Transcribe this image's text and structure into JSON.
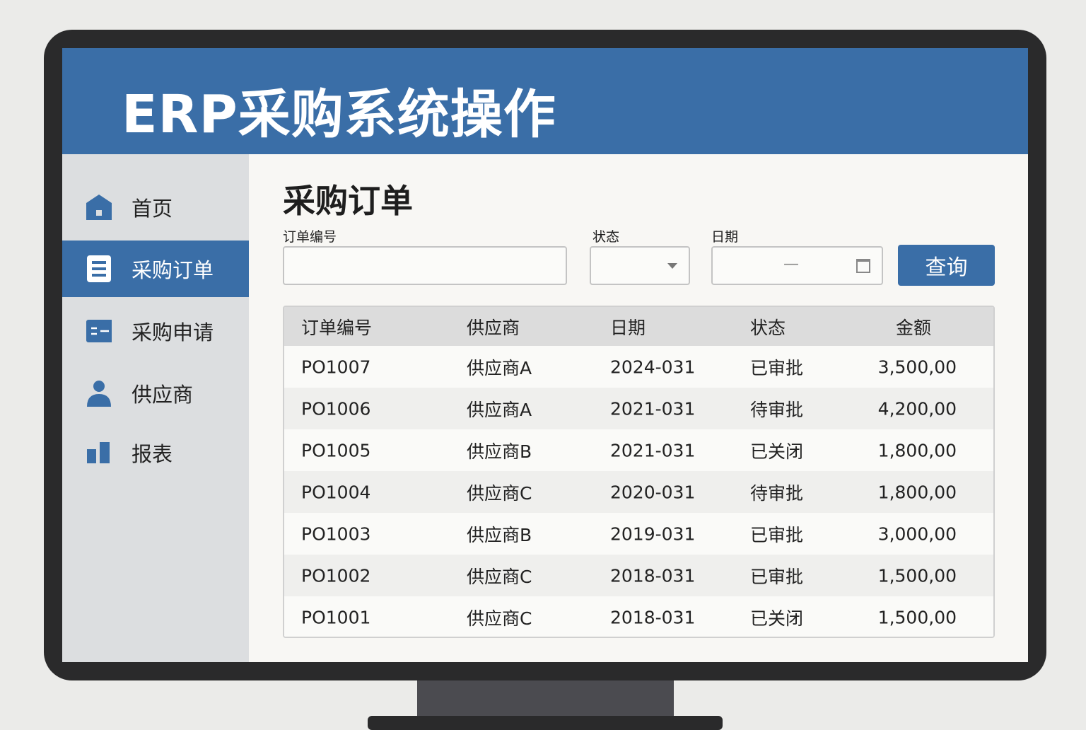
{
  "app_title": "ERP采购系统操作",
  "sidebar": {
    "items": [
      {
        "label": "首页",
        "icon": "home-icon"
      },
      {
        "label": "采购订单",
        "icon": "document-icon",
        "active": true
      },
      {
        "label": "采购申请",
        "icon": "request-icon"
      },
      {
        "label": "供应商",
        "icon": "user-icon"
      },
      {
        "label": "报表",
        "icon": "bar-chart-icon"
      }
    ]
  },
  "main": {
    "title": "采购订单",
    "filters": {
      "order_no_label": "订单编号",
      "status_label": "状态",
      "date_label": "日期",
      "date_placeholder": "—",
      "query_label": "查询"
    },
    "table": {
      "headers": [
        "订单编号",
        "供应商",
        "日期",
        "状态",
        "金额"
      ],
      "rows": [
        [
          "PO1007",
          "供应商A",
          "2024-031",
          "已审批",
          "3,500,00"
        ],
        [
          "PO1006",
          "供应商A",
          "2021-031",
          "待审批",
          "4,200,00"
        ],
        [
          "PO1005",
          "供应商B",
          "2021-031",
          "已关闭",
          "1,800,00"
        ],
        [
          "PO1004",
          "供应商C",
          "2020-031",
          "待审批",
          "1,800,00"
        ],
        [
          "PO1003",
          "供应商B",
          "2019-031",
          "已审批",
          "3,000,00"
        ],
        [
          "PO1002",
          "供应商C",
          "2018-031",
          "已审批",
          "1,500,00"
        ],
        [
          "PO1001",
          "供应商C",
          "2018-031",
          "已关闭",
          "1,500,00"
        ]
      ]
    }
  },
  "colors": {
    "accent": "#3a6ea7",
    "sidebar": "#dcdee0"
  }
}
